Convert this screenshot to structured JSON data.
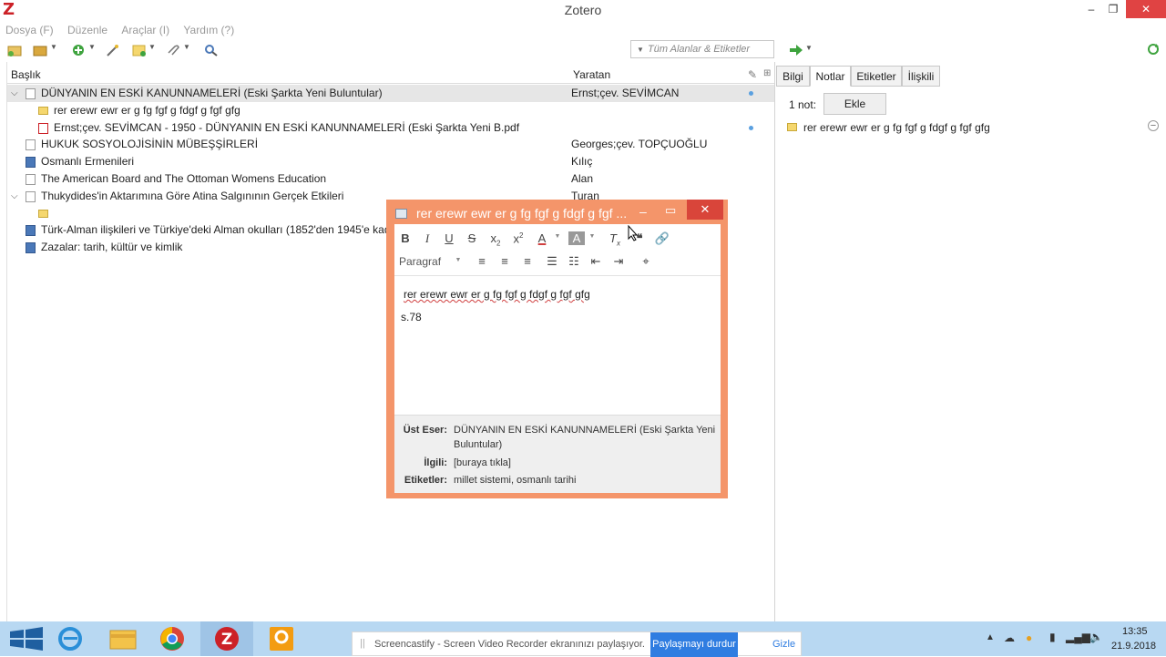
{
  "window": {
    "title": "Zotero",
    "logo": "Z",
    "min": "–",
    "max": "❐",
    "close": "✕"
  },
  "menu": [
    "Dosya (F)",
    "Düzenle",
    "Araçlar (I)",
    "Yardım (?)"
  ],
  "search": {
    "placeholder": "Tüm Alanlar & Etiketler"
  },
  "columns": {
    "title": "Başlık",
    "creator": "Yaratan"
  },
  "items": [
    {
      "title": "DÜNYANIN EN ESKİ KANUNNAMELERİ (Eski Şarkta Yeni Buluntular)",
      "creator": "Ernst;çev. SEVİMCAN",
      "type": "doc",
      "level": 0,
      "expanded": true,
      "selected": true,
      "dot": true
    },
    {
      "title": "rer erewr ewr er g fg fgf g fdgf g fgf gfg",
      "creator": "",
      "type": "note",
      "level": 1
    },
    {
      "title": "Ernst;çev. SEVİMCAN - 1950 - DÜNYANIN EN ESKİ KANUNNAMELERİ (Eski Şarkta Yeni B.pdf",
      "creator": "",
      "type": "pdf",
      "level": 1,
      "dot": true
    },
    {
      "title": "HUKUK SOSYOLOJİSİNİN MÜBEŞŞİRLERİ",
      "creator": "Georges;çev. TOPÇUOĞLU",
      "type": "doc",
      "level": 0
    },
    {
      "title": "Osmanlı Ermenileri",
      "creator": "Kılıç",
      "type": "book",
      "level": 0
    },
    {
      "title": "The American Board and The Ottoman Womens Education",
      "creator": "Alan",
      "type": "doc",
      "level": 0
    },
    {
      "title": "Thukydides'in Aktarımına Göre Atina Salgınının Gerçek Etkileri",
      "creator": "Turan",
      "type": "doc",
      "level": 0,
      "expanded": true
    },
    {
      "title": "",
      "creator": "",
      "type": "note",
      "level": 1
    },
    {
      "title": "Türk-Alman ilişkileri ve Türkiye'deki Alman okulları (1852'den 1945'e kadar)",
      "creator": "",
      "type": "book",
      "level": 0
    },
    {
      "title": "Zazalar: tarih, kültür ve kimlik",
      "creator": "",
      "type": "book",
      "level": 0
    }
  ],
  "right_tabs": [
    "Bilgi",
    "Notlar",
    "Etiketler",
    "İlişkili"
  ],
  "notes": {
    "count_label": "1 not:",
    "add_label": "Ekle",
    "note_title": "rer erewr ewr er g fg fgf g fdgf g fgf gfg",
    "remove": "−"
  },
  "note_window": {
    "title": "rer erewr ewr er g fg fgf g fdgf g fgf ...",
    "paragraph": "Paragraf",
    "line1": "rer erewr ewr er g fg fgf g fdgf g fgf gfg",
    "line2": "s.78",
    "meta": {
      "parent_label": "Üst Eser:",
      "parent_value_1": "DÜNYANIN EN ESKİ KANUNNAMELERİ (Eski Şarkta Yeni",
      "parent_value_2": "Buluntular)",
      "related_label": "İlgili:",
      "related_value": "[buraya tıkla]",
      "tags_label": "Etiketler:",
      "tags_value": "millet sistemi, osmanlı tarihi"
    }
  },
  "taskbar": {
    "cast_text": "Screencastify - Screen Video Recorder ekranınızı paylaşıyor.",
    "cast_stop": "Paylaşmayı durdur",
    "cast_hide": "Gizle",
    "time": "13:35",
    "date": "21.9.2018"
  },
  "colors": {
    "zotero_red": "#cc2127",
    "note_window": "#f4956a",
    "taskbar": "#b8d8f2",
    "cast_button": "#2f7de1"
  }
}
